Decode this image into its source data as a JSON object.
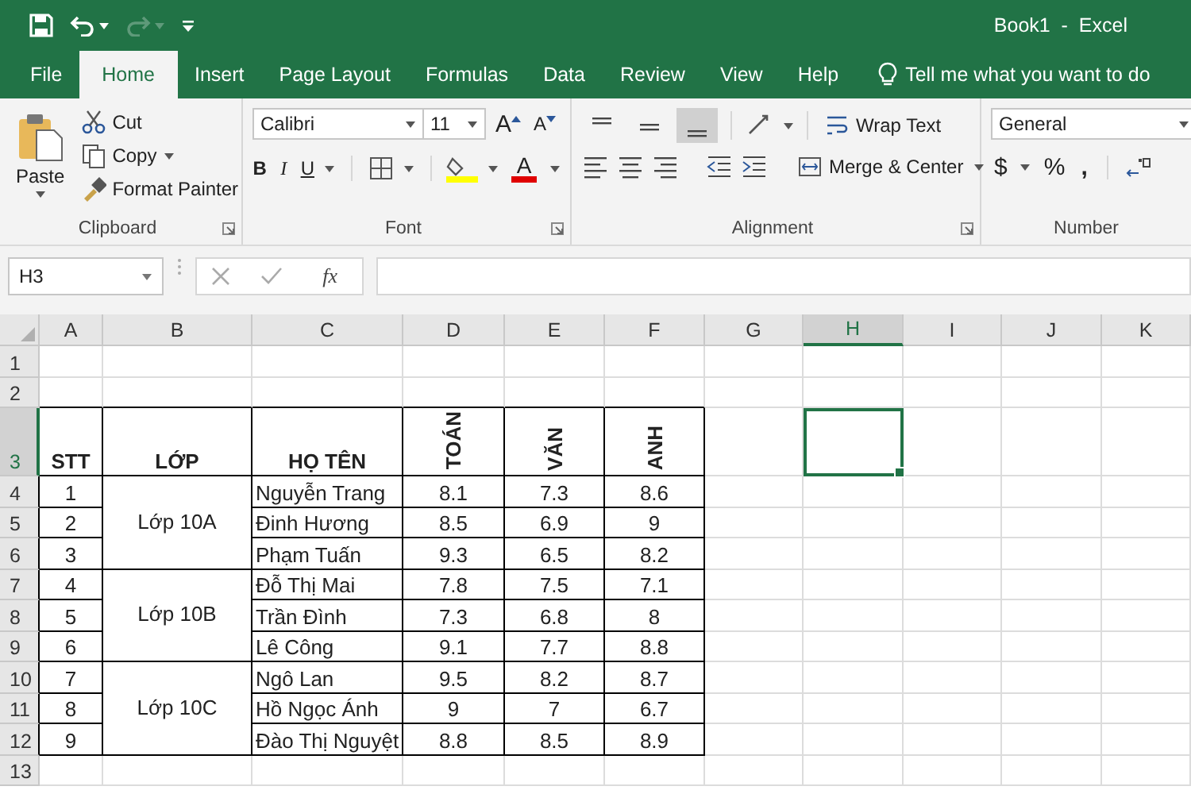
{
  "window": {
    "title": "Book1  -  Excel"
  },
  "quick_access": [
    {
      "kind": "save",
      "disabled": false
    },
    {
      "kind": "undo",
      "disabled": false
    },
    {
      "kind": "redo",
      "disabled": true
    },
    {
      "kind": "customize",
      "disabled": false
    }
  ],
  "tabs": [
    {
      "label": "File",
      "selected": false
    },
    {
      "label": "Home",
      "selected": true
    },
    {
      "label": "Insert",
      "selected": false
    },
    {
      "label": "Page Layout",
      "selected": false
    },
    {
      "label": "Formulas",
      "selected": false
    },
    {
      "label": "Data",
      "selected": false
    },
    {
      "label": "Review",
      "selected": false
    },
    {
      "label": "View",
      "selected": false
    },
    {
      "label": "Help",
      "selected": false
    }
  ],
  "tell_me": "Tell me what you want to do",
  "ribbon": {
    "clipboard": {
      "label": "Clipboard",
      "paste": "Paste",
      "cut": "Cut",
      "copy": "Copy",
      "format_painter": "Format Painter"
    },
    "font": {
      "label": "Font",
      "font_name": "Calibri",
      "font_size": "11",
      "grow": "A",
      "shrink": "A",
      "bold": "B",
      "italic": "I",
      "underline": "U",
      "font_color": "A"
    },
    "alignment": {
      "label": "Alignment",
      "vertical_align": [
        {
          "selected": false
        },
        {
          "selected": false
        },
        {
          "selected": true
        }
      ],
      "wrap_text": "Wrap Text",
      "merge": "Merge & Center"
    },
    "number": {
      "label": "Number",
      "format": "General",
      "currency": "$",
      "percent": "%",
      "comma": ","
    }
  },
  "formula_bar": {
    "name_box": "H3",
    "function_label": "fx"
  },
  "columns": [
    {
      "label": "A",
      "selected": false
    },
    {
      "label": "B",
      "selected": false
    },
    {
      "label": "C",
      "selected": false
    },
    {
      "label": "D",
      "selected": false
    },
    {
      "label": "E",
      "selected": false
    },
    {
      "label": "F",
      "selected": false
    },
    {
      "label": "G",
      "selected": false
    },
    {
      "label": "H",
      "selected": true
    },
    {
      "label": "I",
      "selected": false
    },
    {
      "label": "J",
      "selected": false
    },
    {
      "label": "K",
      "selected": false
    }
  ],
  "rows": [
    {
      "label": "1",
      "selected": false
    },
    {
      "label": "2",
      "selected": false
    },
    {
      "label": "3",
      "selected": true
    },
    {
      "label": "4",
      "selected": false
    },
    {
      "label": "5",
      "selected": false
    },
    {
      "label": "6",
      "selected": false
    },
    {
      "label": "7",
      "selected": false
    },
    {
      "label": "8",
      "selected": false
    },
    {
      "label": "9",
      "selected": false
    },
    {
      "label": "10",
      "selected": false
    },
    {
      "label": "11",
      "selected": false
    },
    {
      "label": "12",
      "selected": false
    },
    {
      "label": "13",
      "selected": false
    }
  ],
  "table": {
    "headers": [
      {
        "label": "STT",
        "vertical": false
      },
      {
        "label": "LỚP",
        "vertical": false
      },
      {
        "label": "HỌ TÊN",
        "vertical": false
      },
      {
        "label": "TOÁN",
        "vertical": true
      },
      {
        "label": "VĂN",
        "vertical": true
      },
      {
        "label": "ANH",
        "vertical": true
      }
    ],
    "groups": [
      {
        "class": "Lớp 10A",
        "students": [
          {
            "stt": "1",
            "name": "Nguyễn Trang",
            "scores": [
              "8.1",
              "7.3",
              "8.6"
            ]
          },
          {
            "stt": "2",
            "name": "Đinh Hương",
            "scores": [
              "8.5",
              "6.9",
              "9"
            ]
          },
          {
            "stt": "3",
            "name": "Phạm Tuấn",
            "scores": [
              "9.3",
              "6.5",
              "8.2"
            ]
          }
        ]
      },
      {
        "class": "Lớp 10B",
        "students": [
          {
            "stt": "4",
            "name": "Đỗ Thị Mai",
            "scores": [
              "7.8",
              "7.5",
              "7.1"
            ]
          },
          {
            "stt": "5",
            "name": "Trần Đình",
            "scores": [
              "7.3",
              "6.8",
              "8"
            ]
          },
          {
            "stt": "6",
            "name": "Lê Công",
            "scores": [
              "9.1",
              "7.7",
              "8.8"
            ]
          }
        ]
      },
      {
        "class": "Lớp 10C",
        "students": [
          {
            "stt": "7",
            "name": "Ngô Lan",
            "scores": [
              "9.5",
              "8.2",
              "8.7"
            ]
          },
          {
            "stt": "8",
            "name": "Hồ Ngọc Ánh",
            "scores": [
              "9",
              "7",
              "6.7"
            ]
          },
          {
            "stt": "9",
            "name": "Đào Thị Nguyệt",
            "scores": [
              "8.8",
              "8.5",
              "8.9"
            ]
          }
        ]
      }
    ]
  }
}
